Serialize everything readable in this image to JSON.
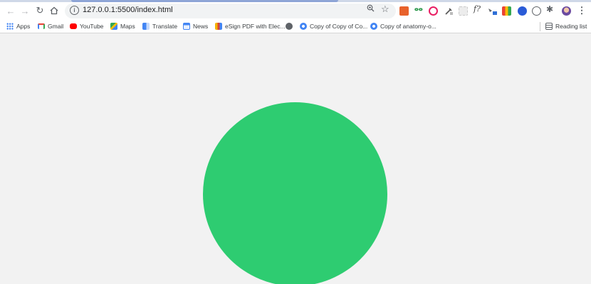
{
  "browser": {
    "url": "127.0.0.1:5500/index.html",
    "reading_list_label": "Reading list"
  },
  "bookmarks": [
    {
      "label": "Apps",
      "icon": "apps-grid-icon",
      "color": "#4285f4"
    },
    {
      "label": "Gmail",
      "icon": "gmail-icon",
      "color": "#ea4335"
    },
    {
      "label": "YouTube",
      "icon": "youtube-icon",
      "color": "#ff0000"
    },
    {
      "label": "Maps",
      "icon": "maps-icon",
      "color": "#34a853"
    },
    {
      "label": "Translate",
      "icon": "translate-icon",
      "color": "#4285f4"
    },
    {
      "label": "News",
      "icon": "news-icon",
      "color": "#4285f4"
    },
    {
      "label": "eSign PDF with Elec...",
      "icon": "esign-icon",
      "color": "#f4b400"
    },
    {
      "label": "",
      "icon": "globe-icon",
      "color": "#5f6368"
    },
    {
      "label": "Copy of Copy of Co...",
      "icon": "chrome-icon",
      "color": "#4285f4"
    },
    {
      "label": "Copy of anatomy-o...",
      "icon": "chrome-icon",
      "color": "#4285f4"
    }
  ],
  "page": {
    "background": "#f2f2f2",
    "circle_color": "#2ecc71"
  }
}
